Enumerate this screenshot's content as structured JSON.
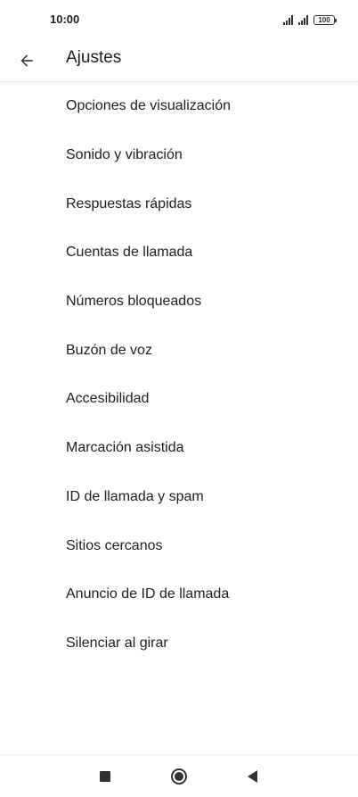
{
  "status_bar": {
    "time": "10:00",
    "battery": "100"
  },
  "app_bar": {
    "title": "Ajustes",
    "back_icon": "arrow-back-icon"
  },
  "settings": {
    "items": [
      {
        "label": "Opciones de visualización"
      },
      {
        "label": "Sonido y vibración"
      },
      {
        "label": "Respuestas rápidas"
      },
      {
        "label": "Cuentas de llamada"
      },
      {
        "label": "Números bloqueados"
      },
      {
        "label": "Buzón de voz"
      },
      {
        "label": "Accesibilidad"
      },
      {
        "label": "Marcación asistida"
      },
      {
        "label": "ID de llamada y spam"
      },
      {
        "label": "Sitios cercanos"
      },
      {
        "label": "Anuncio de ID de llamada"
      },
      {
        "label": "Silenciar al girar"
      }
    ]
  },
  "nav_bar": {
    "recent_icon": "square-icon",
    "home_icon": "circle-icon",
    "back_icon": "triangle-back-icon"
  }
}
